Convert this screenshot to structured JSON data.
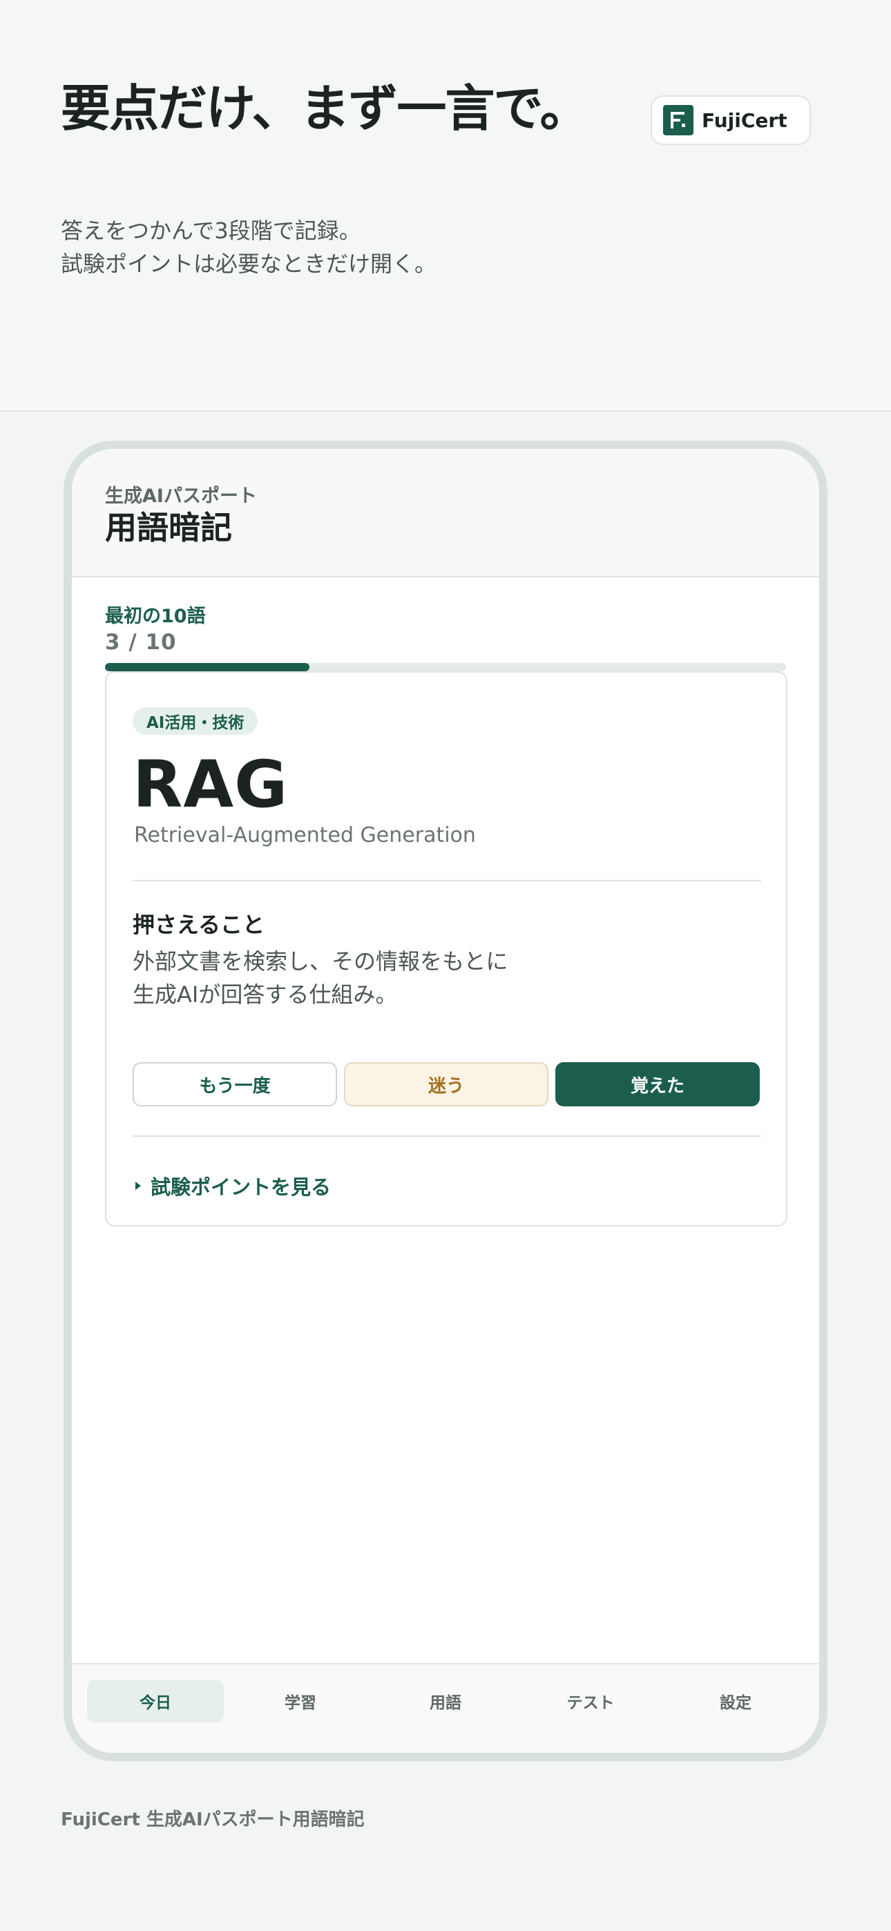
{
  "hero": {
    "headline": "要点だけ、まず一言で。",
    "brand_name": "FujiCert",
    "brand_logo_letter": "F",
    "subcopy": [
      "答えをつかんで3段階で記録。",
      "試験ポイントは必要なときだけ開く。"
    ]
  },
  "app": {
    "subtitle": "生成AIパスポート",
    "title": "用語暗記",
    "set_name": "最初の10語",
    "progress_text": "3 / 10",
    "progress_fraction": 0.3
  },
  "card": {
    "tag": "AI活用・技術",
    "term": "RAG",
    "term_full": "Retrieval-Augmented Generation",
    "keypoint_heading": "押さえること",
    "keypoint_lines": [
      "外部文書を検索し、その情報をもとに",
      "生成AIが回答する仕組み。"
    ],
    "buttons": {
      "again": "もう一度",
      "unsure": "迷う",
      "got_it": "覚えた"
    },
    "details_label": "試験ポイントを見る"
  },
  "tabs": [
    {
      "label": "今日",
      "active": true
    },
    {
      "label": "学習",
      "active": false
    },
    {
      "label": "用語",
      "active": false
    },
    {
      "label": "テスト",
      "active": false
    },
    {
      "label": "設定",
      "active": false
    }
  ],
  "footer": "FujiCert 生成AIパスポート用語暗記",
  "colors": {
    "accent": "#1b5e4e",
    "unsure_bg": "#fbf3e3",
    "unsure_text": "#a46f1d"
  }
}
